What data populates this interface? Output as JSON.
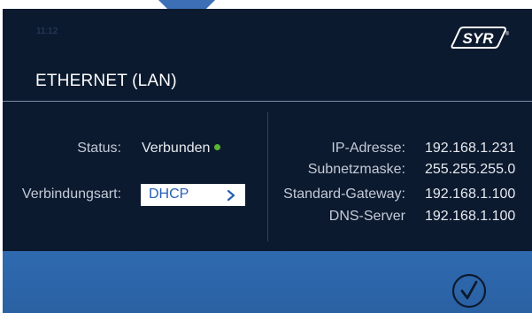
{
  "header": {
    "clock": "11:12",
    "title": "ETHERNET (LAN)",
    "logo_text": "SYR",
    "logo_mark": "®"
  },
  "left": {
    "status_label": "Status:",
    "status_value": "Verbunden",
    "status_color": "#5bb533",
    "connection_type_label": "Verbindungsart:",
    "connection_type_value": "DHCP"
  },
  "right": {
    "ip_label": "IP-Adresse:",
    "ip_value": "192.168.1.231",
    "subnet_label": "Subnetzmaske:",
    "subnet_value": "255.255.255.0",
    "gateway_label": "Standard-Gateway:",
    "gateway_value": "192.168.1.100",
    "dns_label": "DNS-Server",
    "dns_value": "192.168.1.100"
  },
  "footer": {
    "confirm_icon": "checkmark-icon"
  },
  "colors": {
    "background": "#0c1a2f",
    "footer": "#2f6ab0",
    "accent_blue": "#2460b4"
  }
}
